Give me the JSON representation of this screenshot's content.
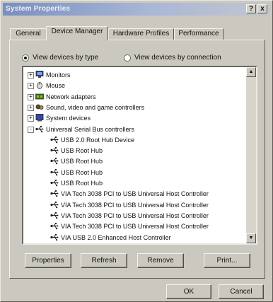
{
  "window": {
    "title": "System Properties",
    "help_label": "?",
    "close_label": "x"
  },
  "tabs": [
    {
      "label": "General",
      "active": false
    },
    {
      "label": "Device Manager",
      "active": true
    },
    {
      "label": "Hardware Profiles",
      "active": false
    },
    {
      "label": "Performance",
      "active": false
    }
  ],
  "view_options": {
    "by_type": "View devices by type",
    "by_connection": "View devices by connection",
    "selected": "by_type"
  },
  "device_tree": [
    {
      "label": "Monitors",
      "level": 0,
      "expander": "+",
      "icon": "monitor-icon"
    },
    {
      "label": "Mouse",
      "level": 0,
      "expander": "+",
      "icon": "mouse-icon"
    },
    {
      "label": "Network adapters",
      "level": 0,
      "expander": "+",
      "icon": "network-adapter-icon"
    },
    {
      "label": "Sound, video and game controllers",
      "level": 0,
      "expander": "+",
      "icon": "sound-controller-icon"
    },
    {
      "label": "System devices",
      "level": 0,
      "expander": "+",
      "icon": "system-device-icon"
    },
    {
      "label": "Universal Serial Bus controllers",
      "level": 0,
      "expander": "-",
      "icon": "usb-icon"
    },
    {
      "label": "USB 2.0 Root Hub Device",
      "level": 1,
      "icon": "usb-icon"
    },
    {
      "label": "USB Root Hub",
      "level": 1,
      "icon": "usb-icon"
    },
    {
      "label": "USB Root Hub",
      "level": 1,
      "icon": "usb-icon"
    },
    {
      "label": "USB Root Hub",
      "level": 1,
      "icon": "usb-icon"
    },
    {
      "label": "USB Root Hub",
      "level": 1,
      "icon": "usb-icon"
    },
    {
      "label": "VIA Tech 3038 PCI to USB Universal Host Controller",
      "level": 1,
      "icon": "usb-icon"
    },
    {
      "label": "VIA Tech 3038 PCI to USB Universal Host Controller",
      "level": 1,
      "icon": "usb-icon"
    },
    {
      "label": "VIA Tech 3038 PCI to USB Universal Host Controller",
      "level": 1,
      "icon": "usb-icon"
    },
    {
      "label": "VIA Tech 3038 PCI to USB Universal Host Controller",
      "level": 1,
      "icon": "usb-icon"
    },
    {
      "label": "VIA USB 2.0 Enhanced Host Controller",
      "level": 1,
      "icon": "usb-icon"
    }
  ],
  "actions": {
    "properties": "Properties",
    "refresh": "Refresh",
    "remove": "Remove",
    "print": "Print..."
  },
  "dialog": {
    "ok": "OK",
    "cancel": "Cancel"
  },
  "colors": {
    "face": "#cbc8bf",
    "title_start": "#7a8fc0",
    "title_end": "#c2c6cf"
  }
}
